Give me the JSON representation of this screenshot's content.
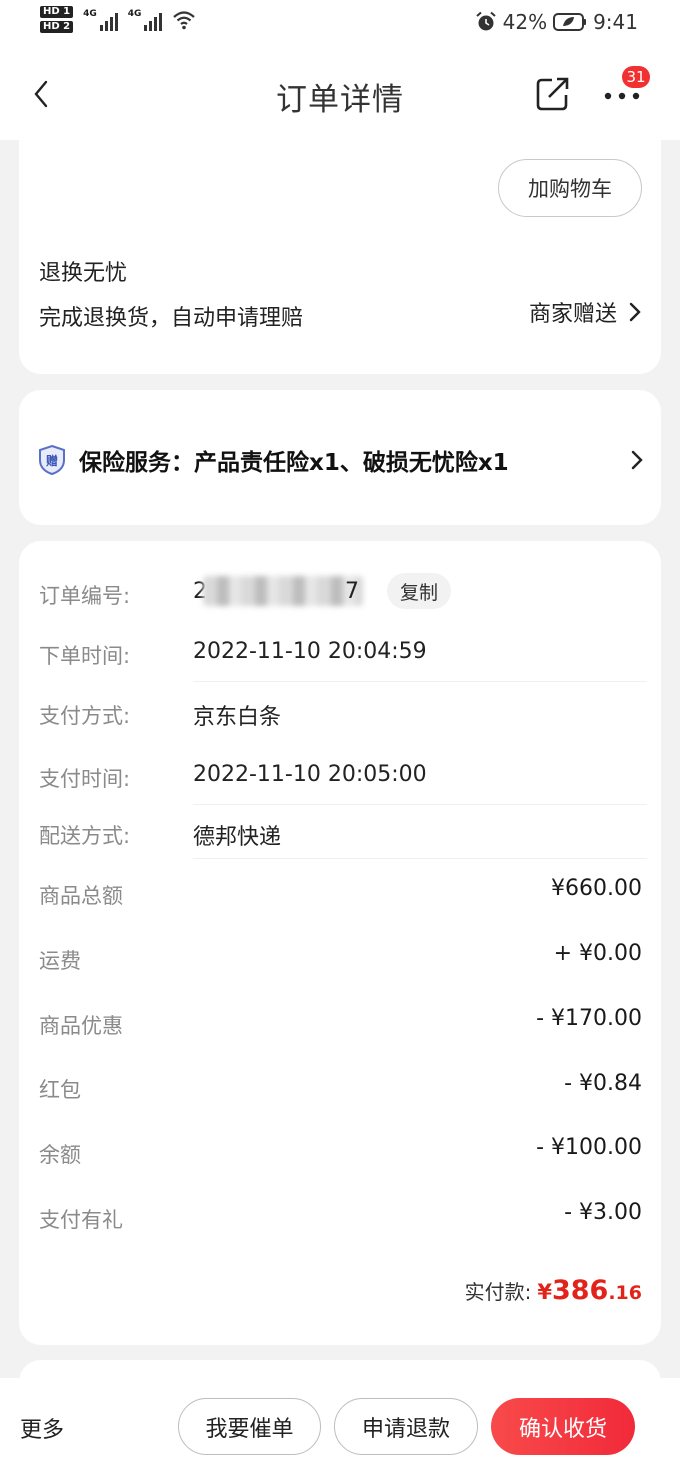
{
  "status_bar": {
    "hd1": "HD 1",
    "hd2": "HD 2",
    "net1": "4G",
    "net2": "4G",
    "battery": "42%",
    "time": "9:41"
  },
  "nav": {
    "title": "订单详情",
    "badge_count": "31"
  },
  "return_card": {
    "cart_button": "加购物车",
    "title": "退换无忧",
    "description": "完成退换货，自动申请理赔",
    "gift_label": "商家赠送"
  },
  "insurance_card": {
    "icon_char": "赠",
    "text": "保险服务：产品责任险x1、破损无忧险x1"
  },
  "order_info": {
    "order_no_label": "订单编号:",
    "order_no_start": "2",
    "order_no_end": "7",
    "copy_button": "复制",
    "order_time_label": "下单时间:",
    "order_time": "2022-11-10 20:04:59",
    "pay_method_label": "支付方式:",
    "pay_method": "京东白条",
    "pay_time_label": "支付时间:",
    "pay_time": "2022-11-10 20:05:00",
    "delivery_label": "配送方式:",
    "delivery": "德邦快递"
  },
  "amounts": [
    {
      "label": "商品总额",
      "value": "¥660.00"
    },
    {
      "label": "运费",
      "value": "+ ¥0.00"
    },
    {
      "label": "商品优惠",
      "value": "- ¥170.00"
    },
    {
      "label": "红包",
      "value": "- ¥0.84"
    },
    {
      "label": "余额",
      "value": "- ¥100.00"
    },
    {
      "label": "支付有礼",
      "value": "- ¥3.00"
    }
  ],
  "total": {
    "label": "实付款:",
    "symbol": "¥",
    "integer": "386",
    "decimal": ".16"
  },
  "bottom_bar": {
    "more": "更多",
    "urge": "我要催单",
    "refund": "申请退款",
    "confirm": "确认收货"
  },
  "colors": {
    "accent_red": "#e2231a",
    "button_red": "#f23030",
    "page_bg": "#f2f2f2"
  }
}
